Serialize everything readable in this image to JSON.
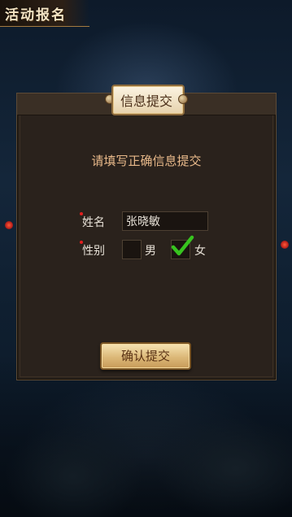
{
  "page": {
    "banner_title": "活动报名"
  },
  "panel": {
    "title": "信息提交",
    "prompt": "请填写正确信息提交"
  },
  "form": {
    "name_label": "姓名",
    "name_value": "张晓敏",
    "gender_label": "性别",
    "gender_options": [
      {
        "label": "男",
        "checked": false
      },
      {
        "label": "女",
        "checked": true
      }
    ],
    "required_marker_color": "#e21e1e",
    "check_color": "#37c41f"
  },
  "actions": {
    "submit_label": "确认提交"
  },
  "colors": {
    "panel_bg": "#2a221c",
    "accent_text": "#e8b98a",
    "button_gold": "#dcb878"
  }
}
